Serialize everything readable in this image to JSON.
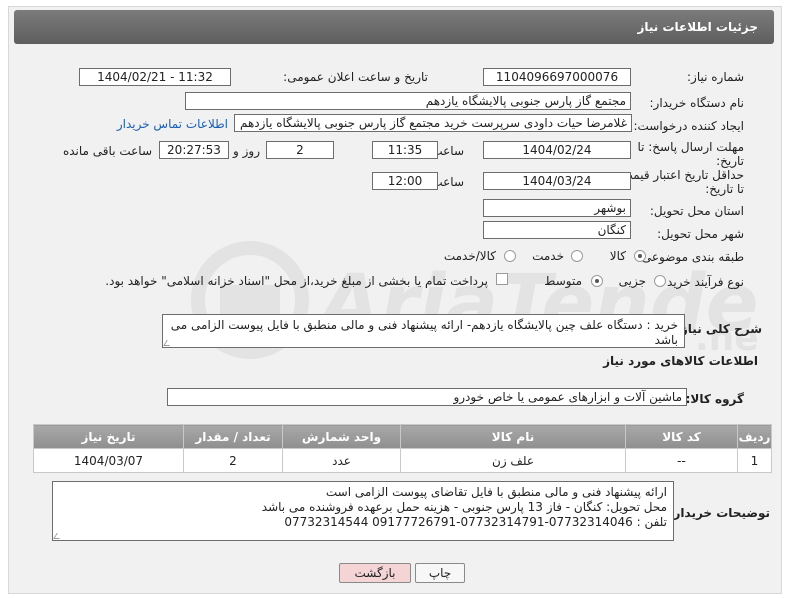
{
  "header": {
    "title": "جزئیات اطلاعات نیاز"
  },
  "fields": {
    "need_number_label": "شماره نیاز:",
    "need_number": "1104096697000076",
    "announce_label": "تاریخ و ساعت اعلان عمومی:",
    "announce_value": "1404/02/21 - 11:32",
    "buyer_org_label": "نام دستگاه خریدار:",
    "buyer_org": "مجتمع گاز پارس جنوبی  پالایشگاه یازدهم",
    "requester_label": "ایجاد کننده درخواست:",
    "requester": "غلامرضا حیات داودی سرپرست خرید مجتمع گاز پارس جنوبی  پالایشگاه یازدهم",
    "contact_link": "اطلاعات تماس خریدار",
    "deadline_label_1": "مهلت ارسال پاسخ: تا",
    "deadline_label_2": "تاریخ:",
    "deadline_date": "1404/02/24",
    "time_label": "ساعت",
    "deadline_time": "11:35",
    "days_value": "2",
    "days_label": "روز و",
    "remaining_time": "20:27:53",
    "remaining_label": "ساعت باقی مانده",
    "validity_label_1": "حداقل تاریخ اعتبار قیمت:",
    "validity_label_2": "تا تاریخ:",
    "validity_date": "1404/03/24",
    "validity_time": "12:00",
    "province_label": "استان محل تحویل:",
    "province": "بوشهر",
    "city_label": "شهر محل تحویل:",
    "city": "کنگان",
    "category_label": "طبقه بندی موضوعی:",
    "category_options": [
      "کالا",
      "خدمت",
      "کالا/خدمت"
    ],
    "category_selected": "کالا",
    "process_label": "نوع فرآیند خرید :",
    "process_options": [
      "جزیی",
      "متوسط"
    ],
    "process_selected": "متوسط",
    "payment_note": "پرداخت تمام یا بخشی از مبلغ خرید،از محل \"اسناد خزانه اسلامی\" خواهد بود."
  },
  "description": {
    "label": "شرح کلی نیاز:",
    "text": "خرید :  دستگاه علف چین پالایشگاه یازدهم- ارائه پیشنهاد فنی و مالی منطبق با فایل پیوست الزامی می باشد"
  },
  "goods_section": {
    "title": "اطلاعات کالاهای مورد نیاز",
    "group_label": "گروه کالا:",
    "group_value": "ماشین آلات و ابزارهای عمومی یا خاص خودرو"
  },
  "table": {
    "headers": [
      "ردیف",
      "کد کالا",
      "نام کالا",
      "واحد شمارش",
      "تعداد / مقدار",
      "تاریخ نیاز"
    ],
    "rows": [
      [
        "1",
        "--",
        "علف زن",
        "عدد",
        "2",
        "1404/03/07"
      ]
    ]
  },
  "buyer_notes": {
    "label": "توضیحات خریدار:",
    "lines": [
      "ارائه پیشنهاد فنی و مالی منطبق با فایل تقاضای پیوست الزامی است",
      "محل تحویل: کنگان - فاز 13 پارس جنوبی - هزینه حمل برعهده فروشنده می باشد",
      "تلفن : 07732314046-0773231479‌1-09177726791 07732314544"
    ]
  },
  "buttons": {
    "print": "چاپ",
    "back": "بازگشت"
  },
  "colors": {
    "header_bg": "#6b6b6b",
    "link": "#1a5fb4",
    "back_btn": "#f4d4d4"
  }
}
